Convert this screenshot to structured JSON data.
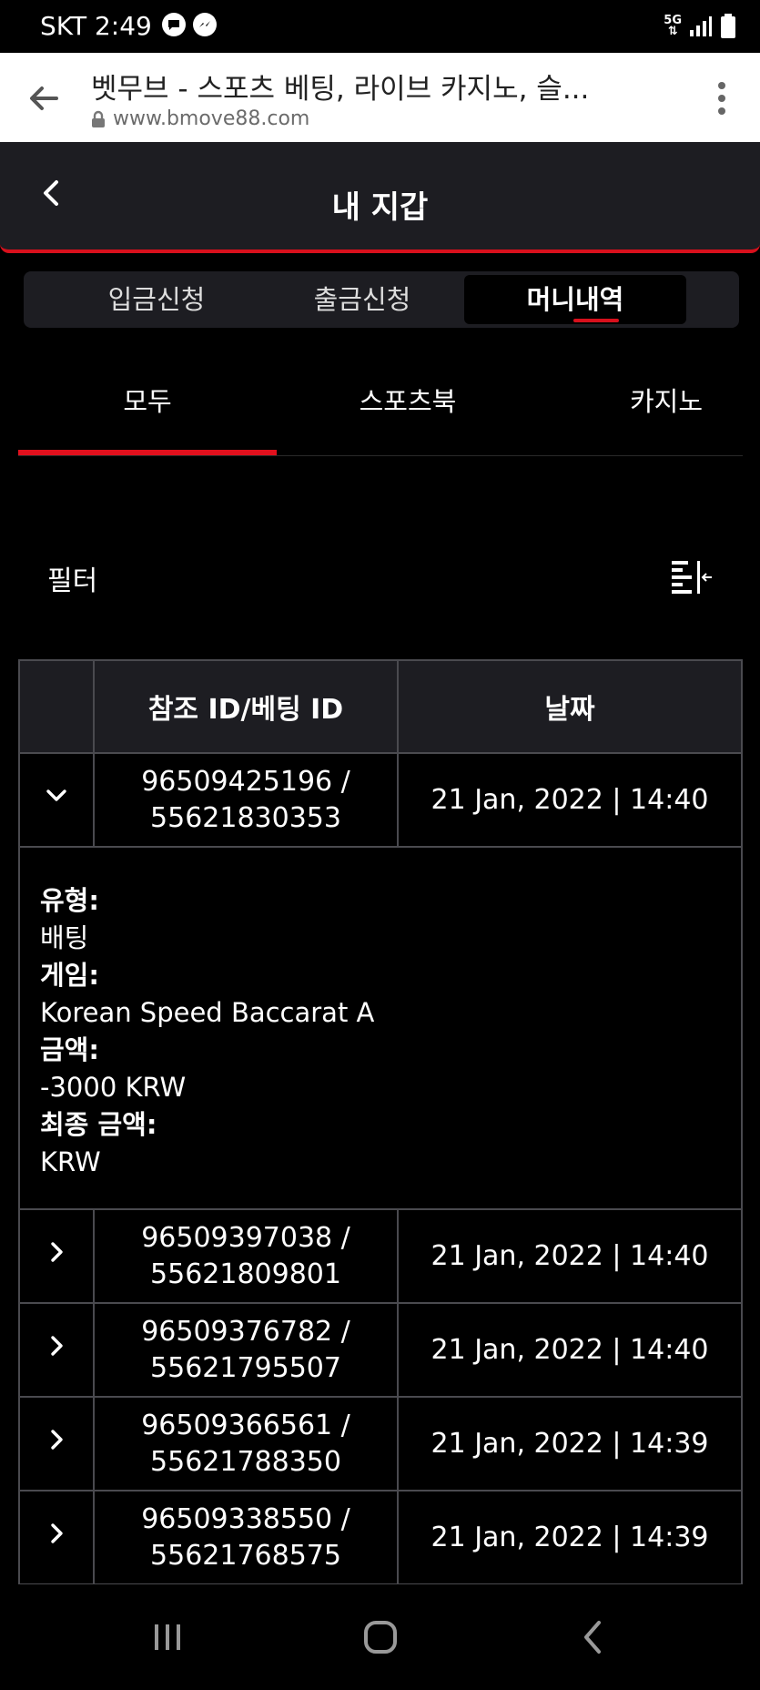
{
  "status_bar": {
    "time": "SKT 2:49",
    "network": "5G"
  },
  "browser": {
    "title": "벳무브 - 스포츠 베팅, 라이브 카지노, 슬...",
    "url": "www.bmove88.com"
  },
  "header": {
    "title": "내 지갑"
  },
  "segments": [
    "입금신청",
    "출금신청",
    "머니내역"
  ],
  "active_segment": "머니내역",
  "categories": [
    "모두",
    "스포츠북",
    "카지노"
  ],
  "active_category": "모두",
  "filter": {
    "label": "필터"
  },
  "table": {
    "headers": {
      "id": "참조 ID/베팅 ID",
      "date": "날짜"
    },
    "rows": [
      {
        "ref_id": "96509425196 /",
        "bet_id": "55621830353",
        "date": "21 Jan, 2022 | 14:40",
        "expanded": true
      },
      {
        "ref_id": "96509397038 /",
        "bet_id": "55621809801",
        "date": "21 Jan, 2022 | 14:40",
        "expanded": false
      },
      {
        "ref_id": "96509376782 /",
        "bet_id": "55621795507",
        "date": "21 Jan, 2022 | 14:40",
        "expanded": false
      },
      {
        "ref_id": "96509366561 /",
        "bet_id": "55621788350",
        "date": "21 Jan, 2022 | 14:39",
        "expanded": false
      },
      {
        "ref_id": "96509338550 /",
        "bet_id": "55621768575",
        "date": "21 Jan, 2022 | 14:39",
        "expanded": false
      }
    ],
    "detail": {
      "type_label": "유형:",
      "type_value": "배팅",
      "game_label": "게임:",
      "game_value": "Korean Speed Baccarat A",
      "amount_label": "금액:",
      "amount_value": "-3000 KRW",
      "final_label": "최종 금액:",
      "final_value": "KRW"
    }
  },
  "colors": {
    "accent": "#d8101c",
    "panel": "#1d1d22",
    "background": "#000000"
  }
}
